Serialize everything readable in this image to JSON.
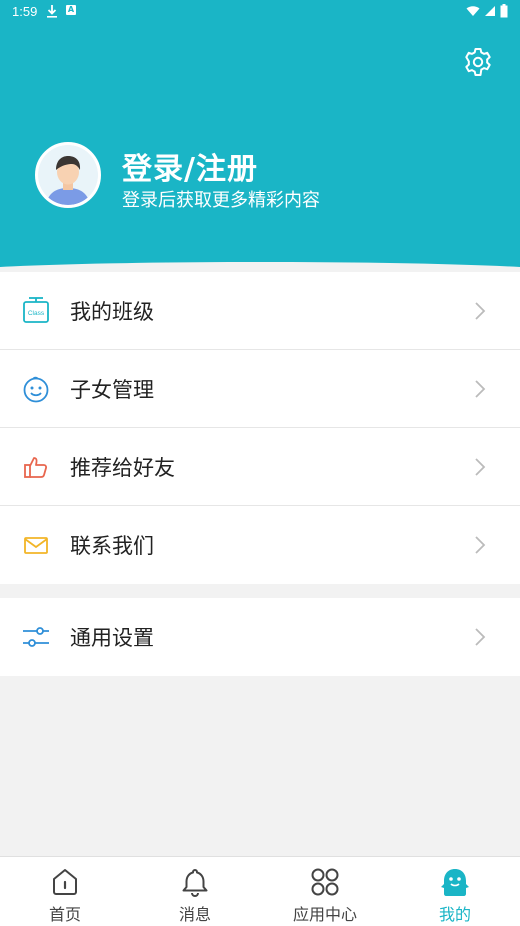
{
  "status": {
    "time": "1:59",
    "a_badge": "A"
  },
  "header": {
    "title": "登录/注册",
    "subtitle": "登录后获取更多精彩内容"
  },
  "menu": {
    "items": [
      {
        "label": "我的班级",
        "icon": "class-icon",
        "badge_text": "Class"
      },
      {
        "label": "子女管理",
        "icon": "child-face-icon"
      },
      {
        "label": "推荐给好友",
        "icon": "thumbs-up-icon"
      },
      {
        "label": "联系我们",
        "icon": "mail-icon"
      }
    ],
    "settings": {
      "label": "通用设置",
      "icon": "sliders-icon"
    }
  },
  "nav": {
    "items": [
      {
        "label": "首页",
        "icon": "home-icon"
      },
      {
        "label": "消息",
        "icon": "bell-icon"
      },
      {
        "label": "应用中心",
        "icon": "apps-grid-icon"
      },
      {
        "label": "我的",
        "icon": "profile-mascot-icon",
        "active": true
      }
    ]
  },
  "colors": {
    "accent": "#1ab5c6",
    "background": "#f2f2f2",
    "thumbs": "#e8664e",
    "mail": "#f2b527"
  }
}
